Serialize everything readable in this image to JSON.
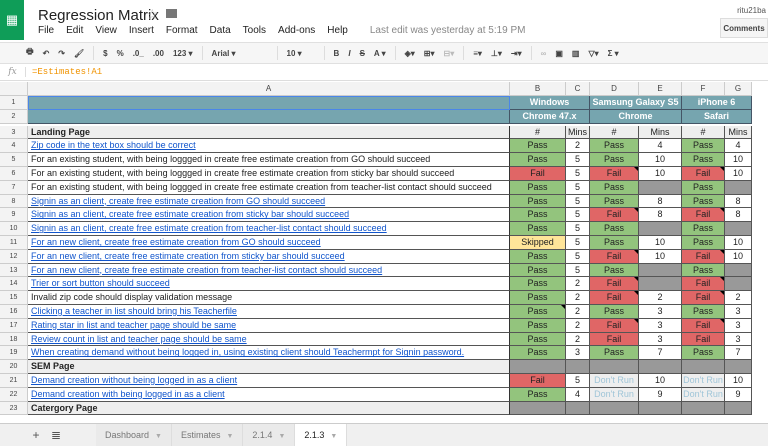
{
  "app": {
    "title": "Regression Matrix",
    "user": "ritu21ba",
    "comments_label": "Comments",
    "last_edit": "Last edit was yesterday at 5:19 PM",
    "menus": [
      "File",
      "Edit",
      "View",
      "Insert",
      "Format",
      "Data",
      "Tools",
      "Add-ons",
      "Help"
    ],
    "toolbar": {
      "currency": "$",
      "percent": "%",
      "dec_less": ".0_",
      "dec_more": ".00",
      "format_more": "123 ▾",
      "font": "Arial ▾",
      "font_size": "10 ▾",
      "bold": "B",
      "italic": "I",
      "strike": "S",
      "text_color": "A ▾",
      "sum": "Σ ▾"
    },
    "formula": "=Estimates!A1"
  },
  "columns": [
    "A",
    "B",
    "C",
    "D",
    "E",
    "F",
    "G"
  ],
  "header_rows": {
    "row1": [
      "Windows",
      "Samsung Galaxy S5",
      "iPhone 6"
    ],
    "row2": [
      "Chrome 47.x",
      "Chrome",
      "Safari"
    ]
  },
  "subheader": [
    "#",
    "Mins",
    "#",
    "Mins",
    "#",
    "Mins"
  ],
  "rows": [
    {
      "n": 3,
      "label": "Landing Page",
      "kind": "section",
      "cells": "subheader"
    },
    {
      "n": 4,
      "label": "Zip code in the text box should be correct",
      "link": true,
      "cells": [
        [
          "Pass",
          "pass"
        ],
        [
          "2",
          "white"
        ],
        [
          "Pass",
          "pass"
        ],
        [
          "4",
          "white"
        ],
        [
          "Pass",
          "pass"
        ],
        [
          "4",
          "white"
        ]
      ]
    },
    {
      "n": 5,
      "label": "For an existing student, with being loggged in create free estimate creation from GO should succeed",
      "cells": [
        [
          "Pass",
          "pass"
        ],
        [
          "5",
          "white"
        ],
        [
          "Pass",
          "pass"
        ],
        [
          "10",
          "white"
        ],
        [
          "Pass",
          "pass"
        ],
        [
          "10",
          "white"
        ]
      ]
    },
    {
      "n": 6,
      "label": "For an existing student, with being loggged in create free estimate creation from sticky bar should succeed",
      "cells": [
        [
          "Fail",
          "fail"
        ],
        [
          "5",
          "white"
        ],
        [
          "Fail",
          "fail note"
        ],
        [
          "10",
          "white"
        ],
        [
          "Fail",
          "fail note"
        ],
        [
          "10",
          "white"
        ]
      ]
    },
    {
      "n": 7,
      "label": "For an existing student, with being loggged in create free estimate creation from teacher-list contact should succeed",
      "cells": [
        [
          "Pass",
          "pass"
        ],
        [
          "5",
          "white"
        ],
        [
          "Pass",
          "pass"
        ],
        [
          "",
          "gray"
        ],
        [
          "Pass",
          "pass"
        ],
        [
          "",
          "gray"
        ]
      ]
    },
    {
      "n": 8,
      "label": "Signin as an client, create free estimate creation from GO should succeed",
      "link": true,
      "cells": [
        [
          "Pass",
          "pass"
        ],
        [
          "5",
          "white"
        ],
        [
          "Pass",
          "pass"
        ],
        [
          "8",
          "white"
        ],
        [
          "Pass",
          "pass"
        ],
        [
          "8",
          "white"
        ]
      ]
    },
    {
      "n": 9,
      "label": "Signin as an client, create free estimate creation from sticky bar should succeed",
      "link": true,
      "cells": [
        [
          "Pass",
          "pass"
        ],
        [
          "5",
          "white"
        ],
        [
          "Fail",
          "fail note"
        ],
        [
          "8",
          "white"
        ],
        [
          "Fail",
          "fail note"
        ],
        [
          "8",
          "white"
        ]
      ]
    },
    {
      "n": 10,
      "label": "Signin as an client, create free estimate creation from teacher-list contact should succeed",
      "link": true,
      "cells": [
        [
          "Pass",
          "pass"
        ],
        [
          "5",
          "white"
        ],
        [
          "Pass",
          "pass"
        ],
        [
          "",
          "gray"
        ],
        [
          "Pass",
          "pass"
        ],
        [
          "",
          "gray"
        ]
      ]
    },
    {
      "n": 11,
      "label": "For an new  client, create free estimate creation from GO should succeed",
      "link": true,
      "cells": [
        [
          "Skipped",
          "skipped"
        ],
        [
          "5",
          "white"
        ],
        [
          "Pass",
          "pass"
        ],
        [
          "10",
          "white"
        ],
        [
          "Pass",
          "pass"
        ],
        [
          "10",
          "white"
        ]
      ]
    },
    {
      "n": 12,
      "label": "For an new  client, create free estimate creation from sticky bar should succeed",
      "link": true,
      "cells": [
        [
          "Pass",
          "pass"
        ],
        [
          "5",
          "white"
        ],
        [
          "Fail",
          "fail note"
        ],
        [
          "10",
          "white"
        ],
        [
          "Fail",
          "fail note"
        ],
        [
          "10",
          "white"
        ]
      ]
    },
    {
      "n": 13,
      "label": "For an new  client, create free estimate creation from teacher-list contact should succeed",
      "link": true,
      "cells": [
        [
          "Pass",
          "pass"
        ],
        [
          "5",
          "white"
        ],
        [
          "Pass",
          "pass"
        ],
        [
          "",
          "gray"
        ],
        [
          "Pass",
          "pass"
        ],
        [
          "",
          "gray"
        ]
      ]
    },
    {
      "n": 14,
      "label": "Trier or sort button should succeed",
      "link": true,
      "cells": [
        [
          "Pass",
          "pass"
        ],
        [
          "2",
          "white"
        ],
        [
          "Fail",
          "fail note"
        ],
        [
          "",
          "gray"
        ],
        [
          "Fail",
          "fail note"
        ],
        [
          "",
          "gray"
        ]
      ]
    },
    {
      "n": 15,
      "label": "Invalid zip code should display validation message",
      "cells": [
        [
          "Pass",
          "pass"
        ],
        [
          "2",
          "white"
        ],
        [
          "Fail",
          "fail note"
        ],
        [
          "2",
          "white"
        ],
        [
          "Fail",
          "fail note"
        ],
        [
          "2",
          "white"
        ]
      ]
    },
    {
      "n": 16,
      "label": "Clicking a teacher in list should bring his Teacherfile",
      "link": true,
      "cells": [
        [
          "Pass",
          "pass note"
        ],
        [
          "2",
          "white"
        ],
        [
          "Pass",
          "pass"
        ],
        [
          "3",
          "white"
        ],
        [
          "Pass",
          "pass"
        ],
        [
          "3",
          "white"
        ]
      ]
    },
    {
      "n": 17,
      "label": "Rating star in list and teacher page should be same",
      "link": true,
      "cells": [
        [
          "Pass",
          "pass"
        ],
        [
          "2",
          "white"
        ],
        [
          "Fail",
          "fail note"
        ],
        [
          "3",
          "white"
        ],
        [
          "Fail",
          "fail note"
        ],
        [
          "3",
          "white"
        ]
      ]
    },
    {
      "n": 18,
      "label": "Review count in list and teacher page should be same",
      "link": true,
      "cells": [
        [
          "Pass",
          "pass"
        ],
        [
          "2",
          "white"
        ],
        [
          "Fail",
          "fail"
        ],
        [
          "3",
          "white"
        ],
        [
          "Fail",
          "fail"
        ],
        [
          "3",
          "white"
        ]
      ]
    },
    {
      "n": 19,
      "label": "When creating demand without being logged in, using existing client should Teachermpt for Signin password.",
      "link": true,
      "cells": [
        [
          "Pass",
          "pass"
        ],
        [
          "3",
          "white"
        ],
        [
          "Pass",
          "pass"
        ],
        [
          "7",
          "white"
        ],
        [
          "Pass",
          "pass"
        ],
        [
          "7",
          "white"
        ]
      ]
    },
    {
      "n": 20,
      "label": "SEM Page",
      "kind": "section",
      "cells": [
        [
          "",
          "gray"
        ],
        [
          "",
          "gray"
        ],
        [
          "",
          "gray"
        ],
        [
          "",
          "gray"
        ],
        [
          "",
          "gray"
        ],
        [
          "",
          "gray"
        ]
      ]
    },
    {
      "n": 21,
      "label": "Demand creation without being logged in as a client",
      "link": true,
      "cells": [
        [
          "Fail",
          "fail"
        ],
        [
          "5",
          "white"
        ],
        [
          "Don't Run",
          "dontrun"
        ],
        [
          "10",
          "white"
        ],
        [
          "Don't Run",
          "dontrun"
        ],
        [
          "10",
          "white"
        ]
      ]
    },
    {
      "n": 22,
      "label": "Demand creation with being logged in as a client",
      "link": true,
      "cells": [
        [
          "Pass",
          "pass"
        ],
        [
          "4",
          "white"
        ],
        [
          "Don't Run",
          "dontrun"
        ],
        [
          "9",
          "white"
        ],
        [
          "Don't Run",
          "dontrun"
        ],
        [
          "9",
          "white"
        ]
      ]
    },
    {
      "n": 23,
      "label": "Catergory Page",
      "kind": "section",
      "cells": [
        [
          "",
          "gray"
        ],
        [
          "",
          "gray"
        ],
        [
          "",
          "gray"
        ],
        [
          "",
          "gray"
        ],
        [
          "",
          "gray"
        ],
        [
          "",
          "gray"
        ]
      ]
    }
  ],
  "sheets": [
    {
      "label": "Dashboard"
    },
    {
      "label": "Estimates"
    },
    {
      "label": "2.1.4"
    },
    {
      "label": "2.1.3",
      "active": true
    }
  ],
  "colors": {
    "pass": "#93c47d",
    "fail": "#e06666",
    "skipped": "#ffe599",
    "header": "#76a5af",
    "brand": "#0f9d58"
  }
}
